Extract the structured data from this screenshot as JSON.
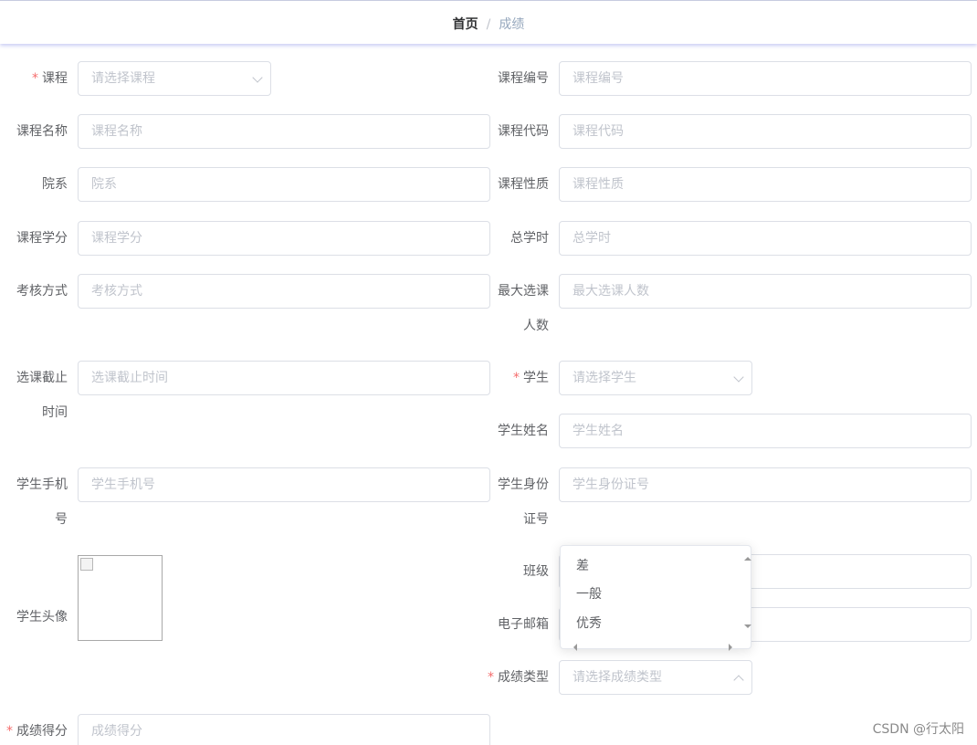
{
  "breadcrumb": {
    "home": "首页",
    "separator": "/",
    "current": "成绩"
  },
  "form": {
    "course": {
      "label": "课程",
      "placeholder": "请选择课程"
    },
    "course_no": {
      "label": "课程编号",
      "placeholder": "课程编号"
    },
    "course_name": {
      "label": "课程名称",
      "placeholder": "课程名称"
    },
    "course_code": {
      "label": "课程代码",
      "placeholder": "课程代码"
    },
    "department": {
      "label": "院系",
      "placeholder": "院系"
    },
    "course_nature": {
      "label": "课程性质",
      "placeholder": "课程性质"
    },
    "credits": {
      "label": "课程学分",
      "placeholder": "课程学分"
    },
    "total_hours": {
      "label": "总学时",
      "placeholder": "总学时"
    },
    "assessment": {
      "label": "考核方式",
      "placeholder": "考核方式"
    },
    "max_students": {
      "label_line1": "最大选课",
      "label_line2": "人数",
      "placeholder": "最大选课人数"
    },
    "deadline": {
      "label_line1": "选课截止",
      "label_line2": "时间",
      "placeholder": "选课截止时间"
    },
    "student": {
      "label": "学生",
      "placeholder": "请选择学生"
    },
    "student_name": {
      "label": "学生姓名",
      "placeholder": "学生姓名"
    },
    "student_phone": {
      "label_line1": "学生手机",
      "label_line2": "号",
      "placeholder": "学生手机号"
    },
    "student_id": {
      "label_line1": "学生身份",
      "label_line2": "证号",
      "placeholder": "学生身份证号"
    },
    "avatar": {
      "label": "学生头像"
    },
    "class": {
      "label": "班级"
    },
    "email": {
      "label": "电子邮箱"
    },
    "grade_type": {
      "label": "成绩类型",
      "placeholder": "请选择成绩类型",
      "options": [
        "差",
        "一般",
        "优秀"
      ]
    },
    "score": {
      "label": "成绩得分",
      "placeholder": "成绩得分"
    }
  },
  "watermark": "CSDN @行太阳",
  "colors": {
    "required": "#f56c6c",
    "border": "#dcdfe6",
    "placeholder": "#c0c4cc",
    "label": "#606266"
  }
}
